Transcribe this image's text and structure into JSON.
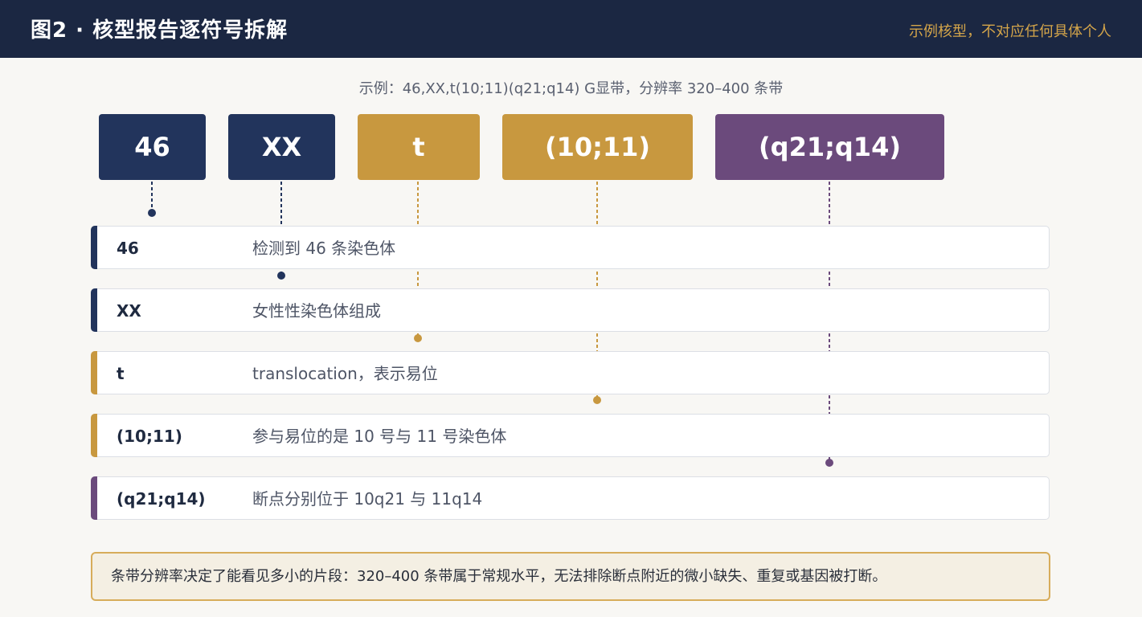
{
  "header": {
    "title": "图2 · 核型报告逐符号拆解",
    "note": "示例核型，不对应任何具体个人"
  },
  "example_text": "示例：46,XX,t(10;11)(q21;q14)    G显带，分辨率 320–400 条带",
  "tokens": [
    {
      "label": "46",
      "color": "navy"
    },
    {
      "label": "XX",
      "color": "navy"
    },
    {
      "label": "t",
      "color": "gold"
    },
    {
      "label": "(10;11)",
      "color": "gold"
    },
    {
      "label": "(q21;q14)",
      "color": "purple"
    }
  ],
  "rows": [
    {
      "symbol": "46",
      "description": "检测到 46 条染色体",
      "color": "navy"
    },
    {
      "symbol": "XX",
      "description": "女性性染色体组成",
      "color": "navy"
    },
    {
      "symbol": "t",
      "description": "translocation，表示易位",
      "color": "gold"
    },
    {
      "symbol": "(10;11)",
      "description": "参与易位的是 10 号与 11 号染色体",
      "color": "gold"
    },
    {
      "symbol": "(q21;q14)",
      "description": "断点分别位于 10q21 与 11q14",
      "color": "purple"
    }
  ],
  "footer_text": "条带分辨率决定了能看见多小的片段：320–400 条带属于常规水平，无法排除断点附近的微小缺失、重复或基因被打断。",
  "colors": {
    "navy": "#22345c",
    "gold": "#c8983f",
    "purple": "#6b4a7c",
    "header_bg": "#1b2742",
    "accent_text": "#d4a54a"
  }
}
